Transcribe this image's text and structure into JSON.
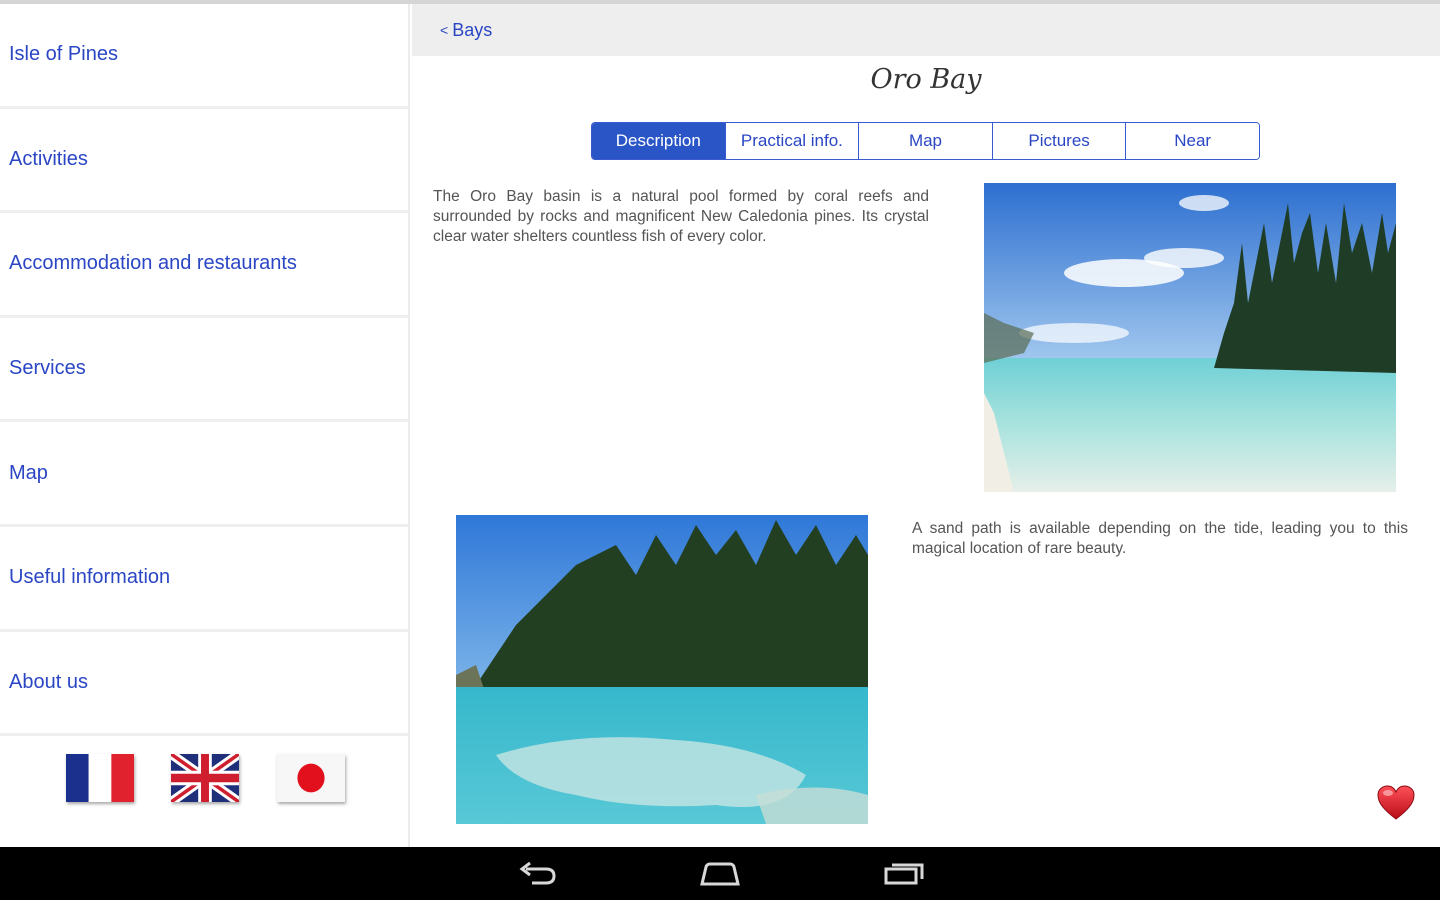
{
  "sidebar": {
    "items": [
      {
        "label": "Isle of Pines"
      },
      {
        "label": "Activities"
      },
      {
        "label": "Accommodation and restaurants"
      },
      {
        "label": "Services"
      },
      {
        "label": "Map"
      },
      {
        "label": "Useful information"
      },
      {
        "label": "About us"
      }
    ],
    "languages": [
      {
        "icon": "france-flag-icon"
      },
      {
        "icon": "uk-flag-icon"
      },
      {
        "icon": "japan-flag-icon"
      }
    ]
  },
  "header": {
    "back_chevron": "<",
    "back_label": "Bays"
  },
  "page": {
    "title": "Oro Bay",
    "tabs": [
      {
        "label": "Description",
        "active": true
      },
      {
        "label": "Practical info.",
        "active": false
      },
      {
        "label": "Map",
        "active": false
      },
      {
        "label": "Pictures",
        "active": false
      },
      {
        "label": "Near",
        "active": false
      }
    ],
    "paragraph1": "The Oro Bay basin is a natural pool formed by coral reefs and surrounded by rocks and magnificent New Caledonia pines. Its crystal clear water shelters countless fish of every color.",
    "paragraph2": "A sand path is available depending on the tide, leading you to this magical location of rare beauty."
  },
  "icons": {
    "favorite": "heart-icon",
    "nav_back": "back-icon",
    "nav_home": "home-icon",
    "nav_recents": "recent-apps-icon"
  },
  "colors": {
    "link": "#2a46c4",
    "tab_active": "#2a55c6",
    "heart": "#d8141e"
  }
}
